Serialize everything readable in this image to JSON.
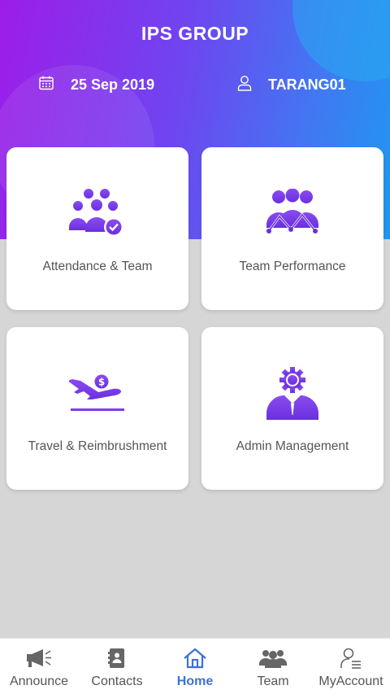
{
  "header": {
    "title": "IPS GROUP",
    "date": "25 Sep 2019",
    "username": "TARANG01",
    "date_icon": "calendar-icon",
    "user_icon": "user-icon"
  },
  "cards": [
    {
      "label": "Attendance & Team",
      "icon": "attendance-team-icon"
    },
    {
      "label": "Team Performance",
      "icon": "team-performance-icon"
    },
    {
      "label": "Travel & Reimbrushment",
      "icon": "travel-reimbursement-icon"
    },
    {
      "label": "Admin Management",
      "icon": "admin-management-icon"
    }
  ],
  "tabbar": {
    "items": [
      {
        "label": "Announce",
        "icon": "megaphone-icon",
        "active": false
      },
      {
        "label": "Contacts",
        "icon": "contacts-book-icon",
        "active": false
      },
      {
        "label": "Home",
        "icon": "home-icon",
        "active": true
      },
      {
        "label": "Team",
        "icon": "team-icon",
        "active": false
      },
      {
        "label": "MyAccount",
        "icon": "account-icon",
        "active": false
      }
    ]
  },
  "colors": {
    "accent_purple": "#7c3aed",
    "active_tab": "#3c73d8",
    "gradient_start": "#9d1de8",
    "gradient_end": "#1f97f0"
  }
}
